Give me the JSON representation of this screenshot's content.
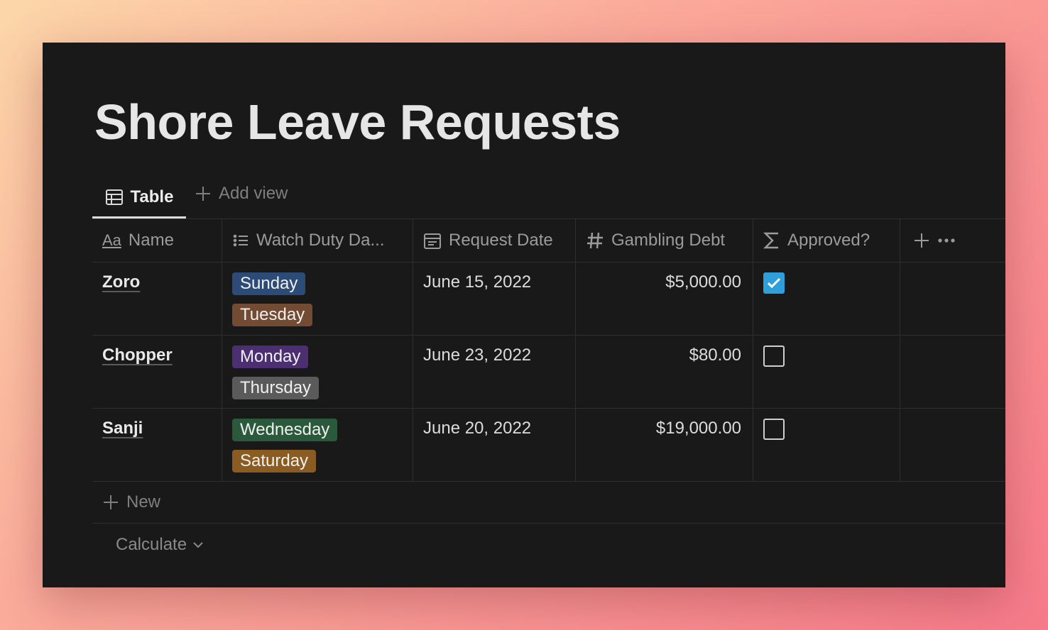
{
  "page": {
    "title": "Shore Leave Requests"
  },
  "views": {
    "active_label": "Table",
    "add_label": "Add view"
  },
  "columns": [
    {
      "label": "Name",
      "icon": "text-type-icon"
    },
    {
      "label": "Watch Duty Da...",
      "icon": "list-icon"
    },
    {
      "label": "Request Date",
      "icon": "calendar-icon"
    },
    {
      "label": "Gambling Debt",
      "icon": "number-icon"
    },
    {
      "label": "Approved?",
      "icon": "sigma-icon"
    }
  ],
  "rows": [
    {
      "name": "Zoro",
      "days": [
        {
          "label": "Sunday",
          "color": "#2c4b77"
        },
        {
          "label": "Tuesday",
          "color": "#734a32"
        }
      ],
      "date": "June 15, 2022",
      "debt": "$5,000.00",
      "approved": true
    },
    {
      "name": "Chopper",
      "days": [
        {
          "label": "Monday",
          "color": "#4b2f70"
        },
        {
          "label": "Thursday",
          "color": "#5a5a5a"
        }
      ],
      "date": "June 23, 2022",
      "debt": "$80.00",
      "approved": false
    },
    {
      "name": "Sanji",
      "days": [
        {
          "label": "Wednesday",
          "color": "#2a5a3b"
        },
        {
          "label": "Saturday",
          "color": "#8a5c22"
        }
      ],
      "date": "June 20, 2022",
      "debt": "$19,000.00",
      "approved": false
    }
  ],
  "footer": {
    "new_label": "New",
    "calculate_label": "Calculate"
  },
  "colors": {
    "background": "#191919",
    "checkbox_checked": "#2e9fd8"
  }
}
